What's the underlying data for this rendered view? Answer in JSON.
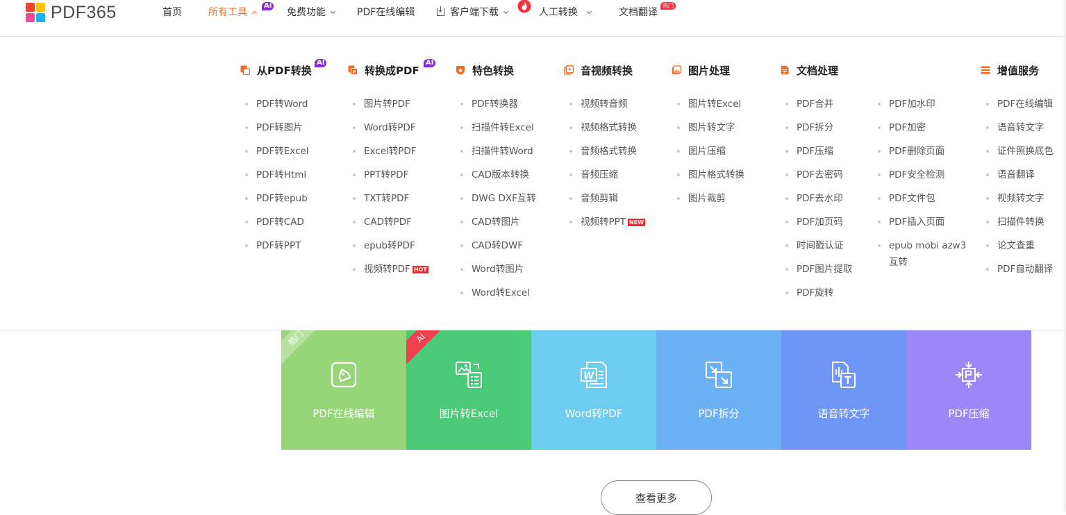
{
  "brand": {
    "logo_text": "PDF365"
  },
  "nav": {
    "home": "首页",
    "all_tools": "所有工具",
    "all_tools_tag": "AI",
    "free": "免费功能",
    "online_edit": "PDF在线编辑",
    "client_download": "客户端下载",
    "manual": "人工转换",
    "translate": "文档翻译",
    "translate_tag": "热门"
  },
  "menu": {
    "columns": [
      {
        "title": "从PDF转换",
        "tag": "AI",
        "icon": "pdf-export-icon",
        "items": [
          "PDF转Word",
          "PDF转图片",
          "PDF转Excel",
          "PDF转Html",
          "PDF转epub",
          "PDF转CAD",
          "PDF转PPT"
        ]
      },
      {
        "title": "转换成PDF",
        "tag": "AI",
        "icon": "pdf-import-icon",
        "items": [
          "图片转PDF",
          "Word转PDF",
          "Excel转PDF",
          "PPT转PDF",
          "TXT转PDF",
          "CAD转PDF",
          "epub转PDF",
          "视频转PDF"
        ],
        "hot_item_tag": "HOT"
      },
      {
        "title": "特色转换",
        "tag": "",
        "icon": "badge-icon",
        "items": [
          "PDF转换器",
          "扫描件转Excel",
          "扫描件转Word",
          "CAD版本转换",
          "DWG DXF互转",
          "CAD转图片",
          "CAD转DWF",
          "Word转图片",
          "Word转Excel"
        ]
      },
      {
        "title": "音视频转换",
        "tag": "",
        "icon": "video-icon",
        "items": [
          "视频转音频",
          "视频格式转换",
          "音频格式转换",
          "音频压缩",
          "音频剪辑",
          "视频转PPT"
        ],
        "new_item_tag": "NEW"
      },
      {
        "title": "图片处理",
        "tag": "",
        "icon": "image-icon",
        "items": [
          "图片转Excel",
          "图片转文字",
          "图片压缩",
          "图片格式转换",
          "图片裁剪"
        ]
      },
      {
        "title": "文档处理",
        "tag": "",
        "icon": "document-icon",
        "items": [
          "PDF合并",
          "PDF拆分",
          "PDF压缩",
          "PDF去密码",
          "PDF去水印",
          "PDF加页码",
          "时间戳认证",
          "PDF图片提取",
          "PDF旋转"
        ]
      },
      {
        "title": "",
        "tag": "",
        "icon": "",
        "items": [
          "PDF加水印",
          "PDF加密",
          "PDF删除页面",
          "PDF安全检测",
          "PDF文件包",
          "PDF插入页面",
          "epub mobi azw3",
          "互转"
        ]
      },
      {
        "title": "增值服务",
        "tag": "",
        "icon": "list-icon",
        "items": [
          "PDF在线编辑",
          "语音转文字",
          "证件照换底色",
          "语音翻译",
          "视频转文字",
          "扫描件转换",
          "论文查重",
          "PDF自动翻译"
        ]
      }
    ]
  },
  "tiles": [
    {
      "label": "PDF在线编辑",
      "color": "#96d678",
      "ribbon": "热门",
      "ribbon_color": "#b6e29e",
      "icon": "edit-icon"
    },
    {
      "label": "图片转Excel",
      "color": "#4bcb78",
      "ribbon": "AI",
      "ribbon_color": "#f2404e",
      "icon": "image-to-excel-icon"
    },
    {
      "label": "Word转PDF",
      "color": "#6ccdf0",
      "ribbon": "",
      "icon": "word-icon"
    },
    {
      "label": "PDF拆分",
      "color": "#6db1f5",
      "ribbon": "",
      "icon": "split-icon"
    },
    {
      "label": "语音转文字",
      "color": "#6f96f7",
      "ribbon": "",
      "icon": "voice-to-text-icon"
    },
    {
      "label": "PDF压缩",
      "color": "#9c87f6",
      "ribbon": "",
      "icon": "compress-icon"
    }
  ],
  "more_button": "查看更多",
  "colors": {
    "accent": "#f26b1d",
    "ai_tag": "#8a2be2",
    "hot_tag": "#f5323c"
  }
}
